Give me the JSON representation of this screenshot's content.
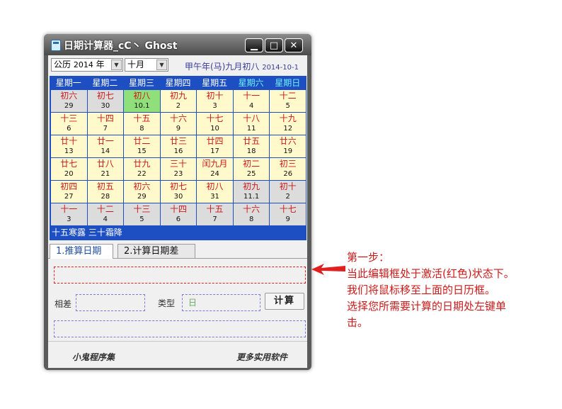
{
  "window": {
    "title": "日期计算器_cC丶 Ghost",
    "min_icon": "minimize-icon",
    "max_icon": "maximize-icon",
    "close_icon": "close-icon"
  },
  "selectors": {
    "calendar_type": "公历",
    "year": "2014",
    "year_suffix": "年",
    "month": "十月"
  },
  "lunar_info": {
    "text": "甲午年(马)九月初八",
    "date": "2014-10-1"
  },
  "weekdays": [
    "星期一",
    "星期二",
    "星期三",
    "星期四",
    "星期五",
    "星期六",
    "星期日"
  ],
  "calendar": [
    [
      [
        "初六",
        "29"
      ],
      [
        "初七",
        "30"
      ],
      [
        "初八",
        "10.1"
      ],
      [
        "初九",
        "2"
      ],
      [
        "初十",
        "3"
      ],
      [
        "十一",
        "4"
      ],
      [
        "十二",
        "5"
      ]
    ],
    [
      [
        "十三",
        "6"
      ],
      [
        "十四",
        "7"
      ],
      [
        "十五",
        "8"
      ],
      [
        "十六",
        "9"
      ],
      [
        "十七",
        "10"
      ],
      [
        "十八",
        "11"
      ],
      [
        "十九",
        "12"
      ]
    ],
    [
      [
        "廿十",
        "13"
      ],
      [
        "廿一",
        "14"
      ],
      [
        "廿二",
        "15"
      ],
      [
        "廿三",
        "16"
      ],
      [
        "廿四",
        "17"
      ],
      [
        "廿五",
        "18"
      ],
      [
        "廿六",
        "19"
      ]
    ],
    [
      [
        "廿七",
        "20"
      ],
      [
        "廿八",
        "21"
      ],
      [
        "廿九",
        "22"
      ],
      [
        "三十",
        "23"
      ],
      [
        "闰九月",
        "24"
      ],
      [
        "初二",
        "25"
      ],
      [
        "初三",
        "26"
      ]
    ],
    [
      [
        "初四",
        "27"
      ],
      [
        "初五",
        "28"
      ],
      [
        "初六",
        "29"
      ],
      [
        "初七",
        "30"
      ],
      [
        "初八",
        "31"
      ],
      [
        "初九",
        "11.1"
      ],
      [
        "初十",
        "2"
      ]
    ],
    [
      [
        "十一",
        "3"
      ],
      [
        "十二",
        "4"
      ],
      [
        "十三",
        "5"
      ],
      [
        "十四",
        "6"
      ],
      [
        "十五",
        "7"
      ],
      [
        "十六",
        "8"
      ],
      [
        "十七",
        "9"
      ]
    ]
  ],
  "solar_terms": "十五寒露   三十霜降",
  "tabs": [
    "1.推算日期",
    "2.计算日期差"
  ],
  "form": {
    "diff_label": "相差",
    "type_label": "类型",
    "type_value": "日",
    "calc_button": "计算"
  },
  "footer": {
    "left": "小鬼程序集",
    "right": "更多实用软件"
  },
  "annotation": [
    "第一步：",
    "当此编辑框处于激活(红色)状态下。",
    "我们将鼠标移至上面的日历框。",
    "选择您所需要计算的日期处左键单",
    "击。"
  ],
  "colors": {
    "active_border": "#e02020",
    "today": "#8fe07a",
    "weekend_header": "#6ff0ff",
    "calendar_frame": "#1e4fc2"
  }
}
